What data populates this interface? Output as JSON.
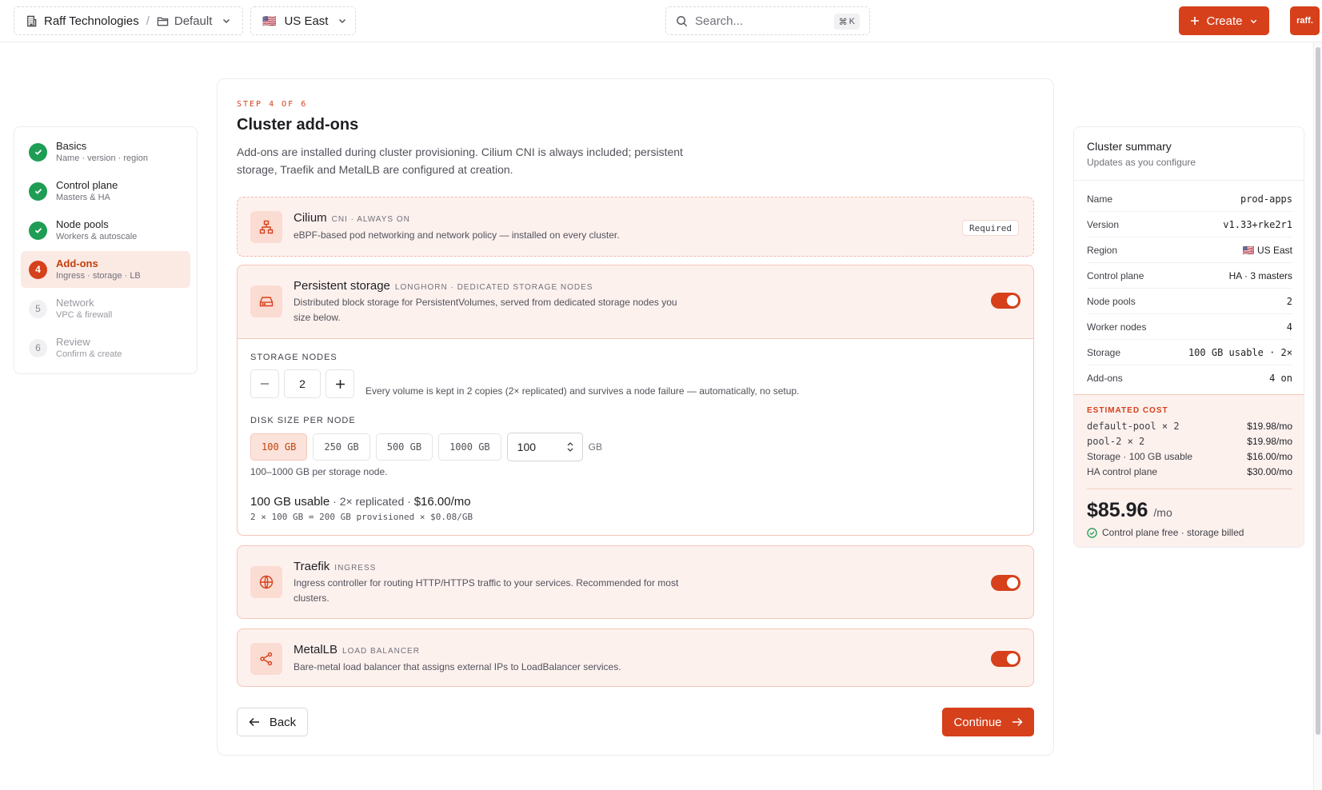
{
  "topbar": {
    "org": "Raff Technologies",
    "project": "Default",
    "region": "US East",
    "region_flag": "🇺🇸",
    "search_placeholder": "Search...",
    "shortcut_key": "K",
    "create_label": "Create",
    "avatar_text": "raff."
  },
  "steps": [
    {
      "title": "Basics",
      "subtitle": "Name · version · region",
      "status": "done"
    },
    {
      "title": "Control plane",
      "subtitle": "Masters & HA",
      "status": "done"
    },
    {
      "title": "Node pools",
      "subtitle": "Workers & autoscale",
      "status": "done"
    },
    {
      "title": "Add-ons",
      "subtitle": "Ingress · storage · LB",
      "status": "current",
      "number": "4"
    },
    {
      "title": "Network",
      "subtitle": "VPC & firewall",
      "status": "todo",
      "number": "5"
    },
    {
      "title": "Review",
      "subtitle": "Confirm & create",
      "status": "todo",
      "number": "6"
    }
  ],
  "main": {
    "eyebrow": "STEP 4 OF 6",
    "title": "Cluster add-ons",
    "description": "Add-ons are installed during cluster provisioning. Cilium CNI is always included; persistent storage, Traefik and MetalLB are configured at creation.",
    "back_label": "Back",
    "continue_label": "Continue"
  },
  "addons": {
    "cilium": {
      "name": "Cilium",
      "tag": "CNI · ALWAYS ON",
      "description": "eBPF-based pod networking and network policy — installed on every cluster.",
      "badge": "Required"
    },
    "storage": {
      "name": "Persistent storage",
      "tag": "LONGHORN · DEDICATED STORAGE NODES",
      "description": "Distributed block storage for PersistentVolumes, served from dedicated storage nodes you size below.",
      "enabled": true
    },
    "traefik": {
      "name": "Traefik",
      "tag": "INGRESS",
      "description": "Ingress controller for routing HTTP/HTTPS traffic to your services. Recommended for most clusters.",
      "enabled": true
    },
    "metallb": {
      "name": "MetalLB",
      "tag": "LOAD BALANCER",
      "description": "Bare-metal load balancer that assigns external IPs to LoadBalancer services.",
      "enabled": true
    }
  },
  "storage_config": {
    "nodes_label": "STORAGE NODES",
    "nodes_value": "2",
    "nodes_hint": "Every volume is kept in 2 copies (2× replicated) and survives a node failure — automatically, no setup.",
    "disk_label": "DISK SIZE PER NODE",
    "size_options": [
      "100 GB",
      "250 GB",
      "500 GB",
      "1000 GB"
    ],
    "selected_size": "100 GB",
    "custom_value": "100",
    "unit": "GB",
    "range_hint": "100–1000 GB per storage node.",
    "usable": "100 GB usable",
    "replicated": " · 2× replicated · ",
    "price": "$16.00/mo",
    "formula": "2 × 100 GB = 200 GB provisioned × $0.08/GB"
  },
  "summary": {
    "title": "Cluster summary",
    "subtitle": "Updates as you configure",
    "rows": [
      {
        "label": "Name",
        "value": "prod-apps",
        "mono": true
      },
      {
        "label": "Version",
        "value": "v1.33+rke2r1",
        "mono": true
      },
      {
        "label": "Region",
        "value": "🇺🇸 US East",
        "mono": false
      },
      {
        "label": "Control plane",
        "value": "HA · 3 masters",
        "mono": false
      },
      {
        "label": "Node pools",
        "value": "2",
        "mono": true
      },
      {
        "label": "Worker nodes",
        "value": "4",
        "mono": true
      },
      {
        "label": "Storage",
        "value": "100 GB usable · 2×",
        "mono": true
      },
      {
        "label": "Add-ons",
        "value": "4 on",
        "mono": true
      }
    ],
    "cost_label": "ESTIMATED COST",
    "costs": [
      {
        "label": "default-pool × 2",
        "value": "$19.98/mo",
        "mono": true
      },
      {
        "label": "pool-2 × 2",
        "value": "$19.98/mo",
        "mono": true
      },
      {
        "label": "Storage · 100 GB usable",
        "value": "$16.00/mo",
        "mono": false
      },
      {
        "label": "HA control plane",
        "value": "$30.00/mo",
        "mono": false
      }
    ],
    "total": "$85.96",
    "per": "/mo",
    "note": "Control plane free · storage billed"
  },
  "colors": {
    "accent": "#d6401b",
    "success": "#1f9d55",
    "accent_tint": "#fdf1ee"
  }
}
